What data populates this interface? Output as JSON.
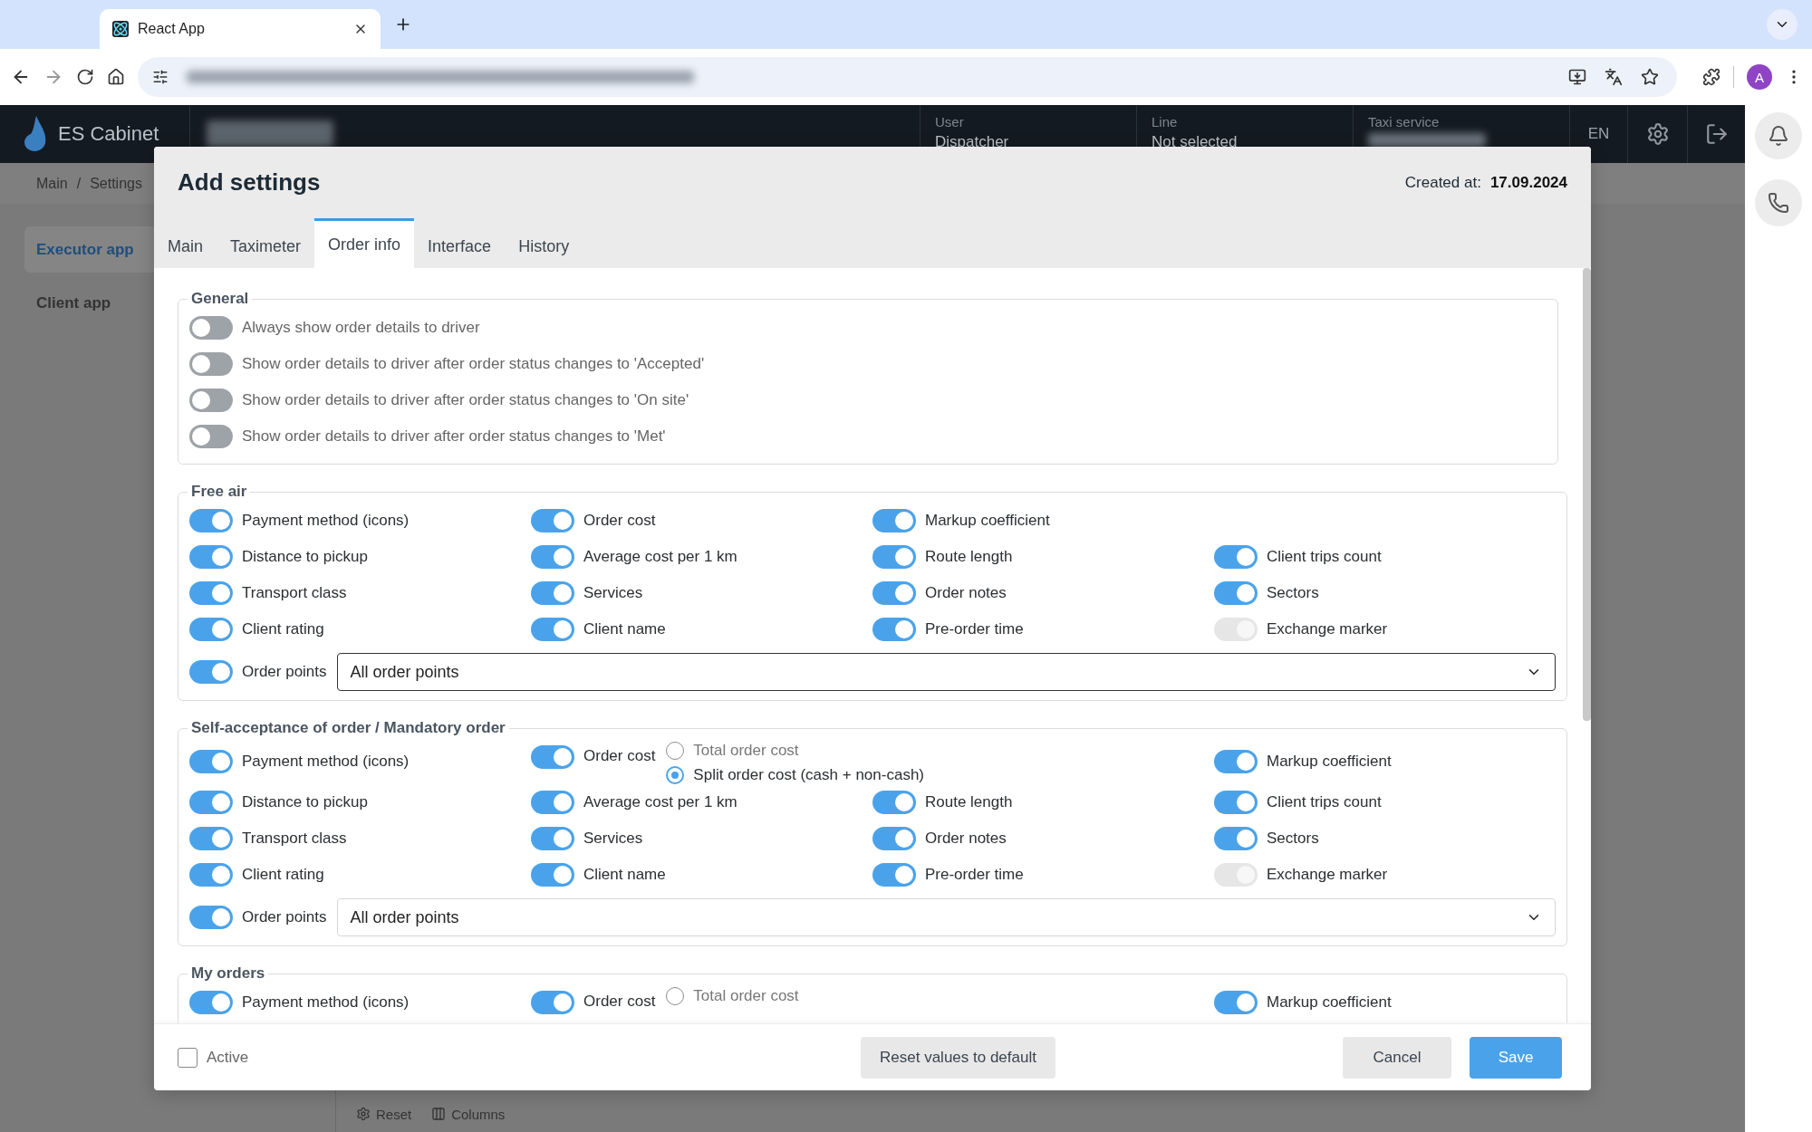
{
  "browser": {
    "tab_title": "React App",
    "profile_initial": "A"
  },
  "app": {
    "brand": "ES Cabinet",
    "header_fields": [
      {
        "label": "User",
        "value": "Dispatcher",
        "redacted": false
      },
      {
        "label": "Line",
        "value": "Not selected",
        "redacted": false
      },
      {
        "label": "Taxi service",
        "redacted": true
      }
    ],
    "language": "EN",
    "breadcrumb": {
      "items": [
        "Main",
        "Settings"
      ],
      "separator": "/"
    },
    "sidebar": [
      {
        "label": "Executor app",
        "selected": true
      },
      {
        "label": "Client app",
        "selected": false
      }
    ],
    "bottom_toolbar": [
      "Reset",
      "Columns"
    ]
  },
  "modal": {
    "title": "Add settings",
    "created_label": "Created at:",
    "created_value": "17.09.2024",
    "tabs": [
      {
        "label": "Main",
        "selected": false
      },
      {
        "label": "Taximeter",
        "selected": false
      },
      {
        "label": "Order info",
        "selected": true
      },
      {
        "label": "Interface",
        "selected": false
      },
      {
        "label": "History",
        "selected": false
      }
    ],
    "sections": [
      {
        "title": "General",
        "kind": "list",
        "items": [
          {
            "label": "Always show order details to driver",
            "on": false,
            "disabled": false
          },
          {
            "label": "Show order details to driver after order status changes to 'Accepted'",
            "on": false,
            "disabled": false
          },
          {
            "label": "Show order details to driver after order status changes to 'On site'",
            "on": false,
            "disabled": false
          },
          {
            "label": "Show order details to driver after order status changes to 'Met'",
            "on": false,
            "disabled": false
          }
        ]
      },
      {
        "title": "Free air",
        "kind": "grid",
        "rows": [
          {
            "cells": [
              {
                "label": "Payment method (icons)",
                "on": true,
                "disabled": false
              },
              {
                "label": "Order cost",
                "on": true,
                "disabled": false
              },
              {
                "label": "Markup coefficient",
                "on": true,
                "disabled": false
              },
              null
            ]
          },
          {
            "cells": [
              {
                "label": "Distance to pickup",
                "on": true,
                "disabled": false
              },
              {
                "label": "Average cost per 1 km",
                "on": true,
                "disabled": false
              },
              {
                "label": "Route length",
                "on": true,
                "disabled": false
              },
              {
                "label": "Client trips count",
                "on": true,
                "disabled": false
              }
            ]
          },
          {
            "cells": [
              {
                "label": "Transport class",
                "on": true,
                "disabled": false
              },
              {
                "label": "Services",
                "on": true,
                "disabled": false
              },
              {
                "label": "Order notes",
                "on": true,
                "disabled": false
              },
              {
                "label": "Sectors",
                "on": true,
                "disabled": false
              }
            ]
          },
          {
            "cells": [
              {
                "label": "Client rating",
                "on": true,
                "disabled": false
              },
              {
                "label": "Client name",
                "on": true,
                "disabled": false
              },
              {
                "label": "Pre-order time",
                "on": true,
                "disabled": false
              },
              {
                "label": "Exchange marker",
                "on": true,
                "disabled": true
              }
            ]
          }
        ],
        "order_points": {
          "label": "Order points",
          "on": true,
          "disabled": false,
          "value": "All order points",
          "focused": true
        }
      },
      {
        "title": "Self-acceptance of order / Mandatory order",
        "kind": "grid",
        "rows": [
          {
            "cells": [
              {
                "label": "Payment method (icons)",
                "on": true,
                "disabled": false
              },
              {
                "label": "Order cost",
                "on": true,
                "disabled": false,
                "options": [
                  {
                    "label": "Total order cost",
                    "selected": false
                  },
                  {
                    "label": "Split order cost (cash + non-cash)",
                    "selected": true
                  }
                ]
              },
              null,
              {
                "label": "Markup coefficient",
                "on": true,
                "disabled": false
              }
            ]
          },
          {
            "cells": [
              {
                "label": "Distance to pickup",
                "on": true,
                "disabled": false
              },
              {
                "label": "Average cost per 1 km",
                "on": true,
                "disabled": false
              },
              {
                "label": "Route length",
                "on": true,
                "disabled": false
              },
              {
                "label": "Client trips count",
                "on": true,
                "disabled": false
              }
            ]
          },
          {
            "cells": [
              {
                "label": "Transport class",
                "on": true,
                "disabled": false
              },
              {
                "label": "Services",
                "on": true,
                "disabled": false
              },
              {
                "label": "Order notes",
                "on": true,
                "disabled": false
              },
              {
                "label": "Sectors",
                "on": true,
                "disabled": false
              }
            ]
          },
          {
            "cells": [
              {
                "label": "Client rating",
                "on": true,
                "disabled": false
              },
              {
                "label": "Client name",
                "on": true,
                "disabled": false
              },
              {
                "label": "Pre-order time",
                "on": true,
                "disabled": false
              },
              {
                "label": "Exchange marker",
                "on": true,
                "disabled": true
              }
            ]
          }
        ],
        "order_points": {
          "label": "Order points",
          "on": true,
          "disabled": false,
          "value": "All order points",
          "focused": false
        }
      },
      {
        "title": "My orders",
        "kind": "grid",
        "rows": [
          {
            "cells": [
              {
                "label": "Payment method (icons)",
                "on": true,
                "disabled": false
              },
              {
                "label": "Order cost",
                "on": true,
                "disabled": false,
                "options": [
                  {
                    "label": "Total order cost",
                    "selected": false
                  }
                ]
              },
              null,
              {
                "label": "Markup coefficient",
                "on": true,
                "disabled": false
              }
            ]
          }
        ]
      }
    ],
    "footer": {
      "active": {
        "label": "Active",
        "checked": false
      },
      "reset_button": "Reset values to default",
      "cancel_button": "Cancel",
      "save_button": "Save"
    }
  }
}
